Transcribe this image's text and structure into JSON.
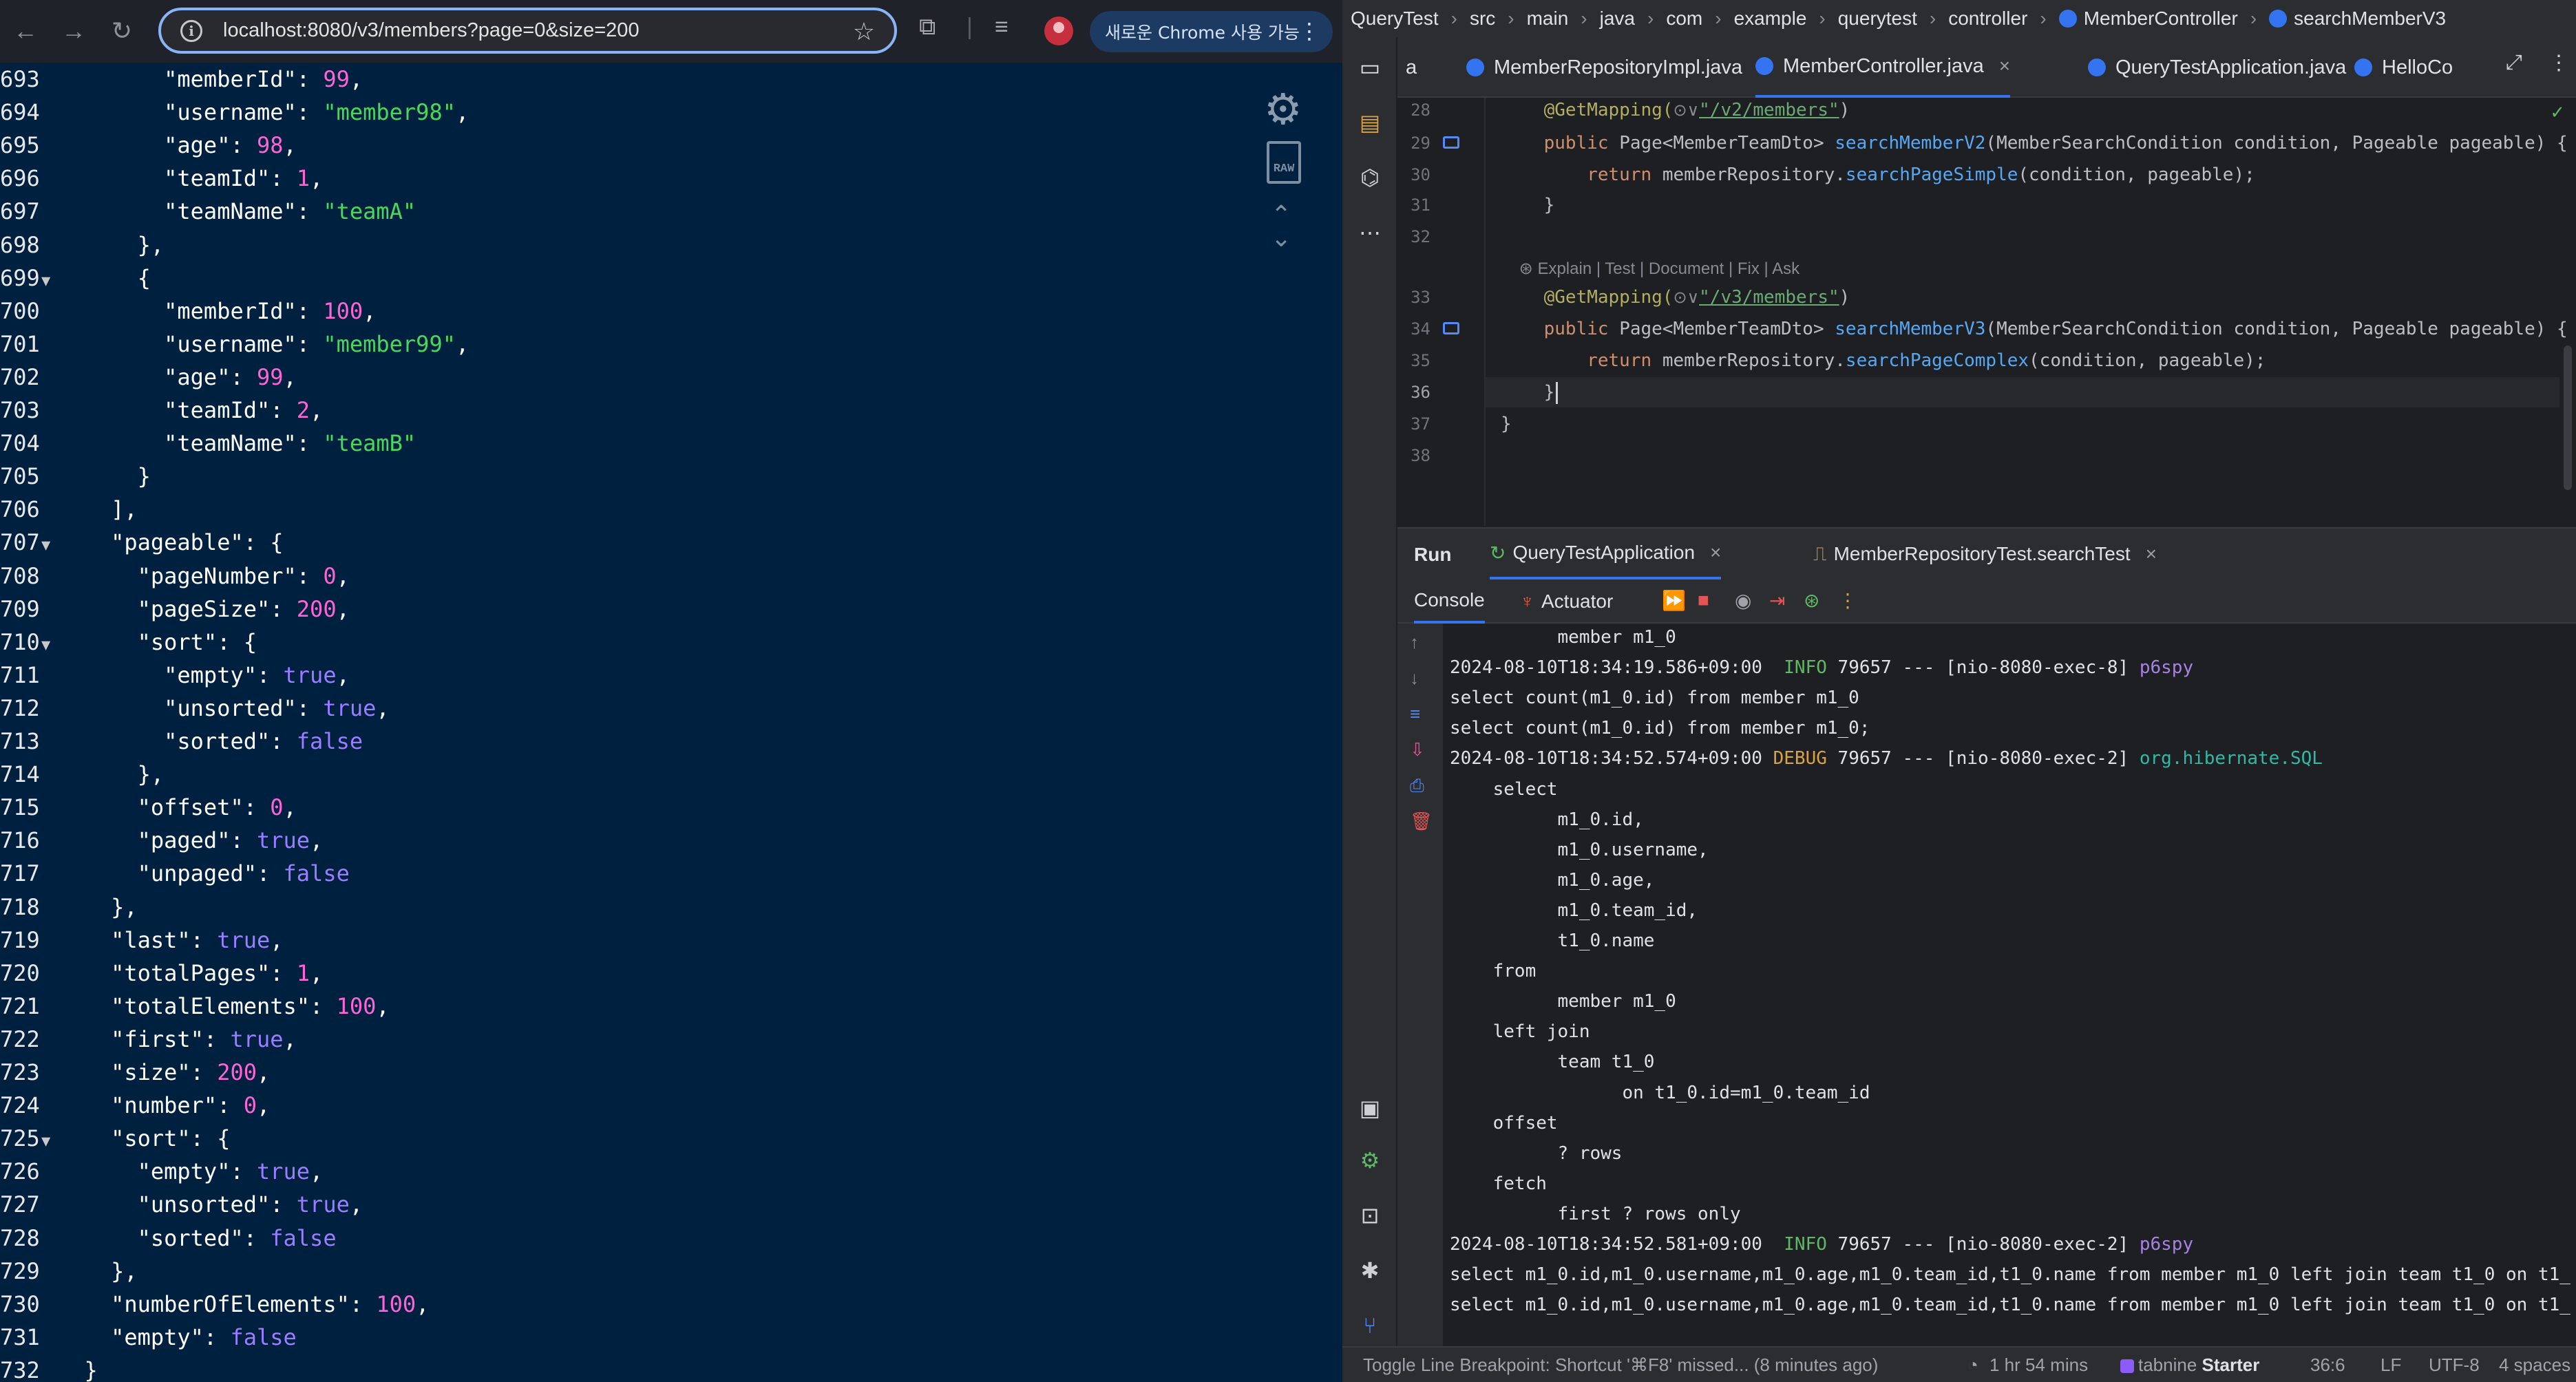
{
  "browser": {
    "url": "localhost:8080/v3/members?page=0&size=200",
    "promo_label": "새로운 Chrome 사용 가능"
  },
  "json_lines": [
    {
      "ln": "693",
      "fold": "",
      "parts": [
        [
          "p",
          "        "
        ],
        [
          "k",
          "\"memberId\""
        ],
        [
          "p",
          ": "
        ],
        [
          "n",
          "99"
        ],
        [
          "p",
          ","
        ]
      ]
    },
    {
      "ln": "694",
      "fold": "",
      "parts": [
        [
          "p",
          "        "
        ],
        [
          "k",
          "\"username\""
        ],
        [
          "p",
          ": "
        ],
        [
          "s",
          "\"member98\""
        ],
        [
          "p",
          ","
        ]
      ]
    },
    {
      "ln": "695",
      "fold": "",
      "parts": [
        [
          "p",
          "        "
        ],
        [
          "k",
          "\"age\""
        ],
        [
          "p",
          ": "
        ],
        [
          "n",
          "98"
        ],
        [
          "p",
          ","
        ]
      ]
    },
    {
      "ln": "696",
      "fold": "",
      "parts": [
        [
          "p",
          "        "
        ],
        [
          "k",
          "\"teamId\""
        ],
        [
          "p",
          ": "
        ],
        [
          "n",
          "1"
        ],
        [
          "p",
          ","
        ]
      ]
    },
    {
      "ln": "697",
      "fold": "",
      "parts": [
        [
          "p",
          "        "
        ],
        [
          "k",
          "\"teamName\""
        ],
        [
          "p",
          ": "
        ],
        [
          "s",
          "\"teamA\""
        ]
      ]
    },
    {
      "ln": "698",
      "fold": "",
      "parts": [
        [
          "p",
          "      },"
        ]
      ]
    },
    {
      "ln": "699",
      "fold": "▼",
      "parts": [
        [
          "p",
          "      {"
        ]
      ]
    },
    {
      "ln": "700",
      "fold": "",
      "parts": [
        [
          "p",
          "        "
        ],
        [
          "k",
          "\"memberId\""
        ],
        [
          "p",
          ": "
        ],
        [
          "n",
          "100"
        ],
        [
          "p",
          ","
        ]
      ]
    },
    {
      "ln": "701",
      "fold": "",
      "parts": [
        [
          "p",
          "        "
        ],
        [
          "k",
          "\"username\""
        ],
        [
          "p",
          ": "
        ],
        [
          "s",
          "\"member99\""
        ],
        [
          "p",
          ","
        ]
      ]
    },
    {
      "ln": "702",
      "fold": "",
      "parts": [
        [
          "p",
          "        "
        ],
        [
          "k",
          "\"age\""
        ],
        [
          "p",
          ": "
        ],
        [
          "n",
          "99"
        ],
        [
          "p",
          ","
        ]
      ]
    },
    {
      "ln": "703",
      "fold": "",
      "parts": [
        [
          "p",
          "        "
        ],
        [
          "k",
          "\"teamId\""
        ],
        [
          "p",
          ": "
        ],
        [
          "n",
          "2"
        ],
        [
          "p",
          ","
        ]
      ]
    },
    {
      "ln": "704",
      "fold": "",
      "parts": [
        [
          "p",
          "        "
        ],
        [
          "k",
          "\"teamName\""
        ],
        [
          "p",
          ": "
        ],
        [
          "s",
          "\"teamB\""
        ]
      ]
    },
    {
      "ln": "705",
      "fold": "",
      "parts": [
        [
          "p",
          "      }"
        ]
      ]
    },
    {
      "ln": "706",
      "fold": "",
      "parts": [
        [
          "p",
          "    ],"
        ]
      ]
    },
    {
      "ln": "707",
      "fold": "▼",
      "parts": [
        [
          "p",
          "    "
        ],
        [
          "k",
          "\"pageable\""
        ],
        [
          "p",
          ": {"
        ]
      ]
    },
    {
      "ln": "708",
      "fold": "",
      "parts": [
        [
          "p",
          "      "
        ],
        [
          "k",
          "\"pageNumber\""
        ],
        [
          "p",
          ": "
        ],
        [
          "n",
          "0"
        ],
        [
          "p",
          ","
        ]
      ]
    },
    {
      "ln": "709",
      "fold": "",
      "parts": [
        [
          "p",
          "      "
        ],
        [
          "k",
          "\"pageSize\""
        ],
        [
          "p",
          ": "
        ],
        [
          "n",
          "200"
        ],
        [
          "p",
          ","
        ]
      ]
    },
    {
      "ln": "710",
      "fold": "▼",
      "parts": [
        [
          "p",
          "      "
        ],
        [
          "k",
          "\"sort\""
        ],
        [
          "p",
          ": {"
        ]
      ]
    },
    {
      "ln": "711",
      "fold": "",
      "parts": [
        [
          "p",
          "        "
        ],
        [
          "k",
          "\"empty\""
        ],
        [
          "p",
          ": "
        ],
        [
          "b",
          "true"
        ],
        [
          "p",
          ","
        ]
      ]
    },
    {
      "ln": "712",
      "fold": "",
      "parts": [
        [
          "p",
          "        "
        ],
        [
          "k",
          "\"unsorted\""
        ],
        [
          "p",
          ": "
        ],
        [
          "b",
          "true"
        ],
        [
          "p",
          ","
        ]
      ]
    },
    {
      "ln": "713",
      "fold": "",
      "parts": [
        [
          "p",
          "        "
        ],
        [
          "k",
          "\"sorted\""
        ],
        [
          "p",
          ": "
        ],
        [
          "b",
          "false"
        ]
      ]
    },
    {
      "ln": "714",
      "fold": "",
      "parts": [
        [
          "p",
          "      },"
        ]
      ]
    },
    {
      "ln": "715",
      "fold": "",
      "parts": [
        [
          "p",
          "      "
        ],
        [
          "k",
          "\"offset\""
        ],
        [
          "p",
          ": "
        ],
        [
          "n",
          "0"
        ],
        [
          "p",
          ","
        ]
      ]
    },
    {
      "ln": "716",
      "fold": "",
      "parts": [
        [
          "p",
          "      "
        ],
        [
          "k",
          "\"paged\""
        ],
        [
          "p",
          ": "
        ],
        [
          "b",
          "true"
        ],
        [
          "p",
          ","
        ]
      ]
    },
    {
      "ln": "717",
      "fold": "",
      "parts": [
        [
          "p",
          "      "
        ],
        [
          "k",
          "\"unpaged\""
        ],
        [
          "p",
          ": "
        ],
        [
          "b",
          "false"
        ]
      ]
    },
    {
      "ln": "718",
      "fold": "",
      "parts": [
        [
          "p",
          "    },"
        ]
      ]
    },
    {
      "ln": "719",
      "fold": "",
      "parts": [
        [
          "p",
          "    "
        ],
        [
          "k",
          "\"last\""
        ],
        [
          "p",
          ": "
        ],
        [
          "b",
          "true"
        ],
        [
          "p",
          ","
        ]
      ]
    },
    {
      "ln": "720",
      "fold": "",
      "parts": [
        [
          "p",
          "    "
        ],
        [
          "k",
          "\"totalPages\""
        ],
        [
          "p",
          ": "
        ],
        [
          "n",
          "1"
        ],
        [
          "p",
          ","
        ]
      ]
    },
    {
      "ln": "721",
      "fold": "",
      "parts": [
        [
          "p",
          "    "
        ],
        [
          "k",
          "\"totalElements\""
        ],
        [
          "p",
          ": "
        ],
        [
          "n",
          "100"
        ],
        [
          "p",
          ","
        ]
      ]
    },
    {
      "ln": "722",
      "fold": "",
      "parts": [
        [
          "p",
          "    "
        ],
        [
          "k",
          "\"first\""
        ],
        [
          "p",
          ": "
        ],
        [
          "b",
          "true"
        ],
        [
          "p",
          ","
        ]
      ]
    },
    {
      "ln": "723",
      "fold": "",
      "parts": [
        [
          "p",
          "    "
        ],
        [
          "k",
          "\"size\""
        ],
        [
          "p",
          ": "
        ],
        [
          "n",
          "200"
        ],
        [
          "p",
          ","
        ]
      ]
    },
    {
      "ln": "724",
      "fold": "",
      "parts": [
        [
          "p",
          "    "
        ],
        [
          "k",
          "\"number\""
        ],
        [
          "p",
          ": "
        ],
        [
          "n",
          "0"
        ],
        [
          "p",
          ","
        ]
      ]
    },
    {
      "ln": "725",
      "fold": "▼",
      "parts": [
        [
          "p",
          "    "
        ],
        [
          "k",
          "\"sort\""
        ],
        [
          "p",
          ": {"
        ]
      ]
    },
    {
      "ln": "726",
      "fold": "",
      "parts": [
        [
          "p",
          "      "
        ],
        [
          "k",
          "\"empty\""
        ],
        [
          "p",
          ": "
        ],
        [
          "b",
          "true"
        ],
        [
          "p",
          ","
        ]
      ]
    },
    {
      "ln": "727",
      "fold": "",
      "parts": [
        [
          "p",
          "      "
        ],
        [
          "k",
          "\"unsorted\""
        ],
        [
          "p",
          ": "
        ],
        [
          "b",
          "true"
        ],
        [
          "p",
          ","
        ]
      ]
    },
    {
      "ln": "728",
      "fold": "",
      "parts": [
        [
          "p",
          "      "
        ],
        [
          "k",
          "\"sorted\""
        ],
        [
          "p",
          ": "
        ],
        [
          "b",
          "false"
        ]
      ]
    },
    {
      "ln": "729",
      "fold": "",
      "parts": [
        [
          "p",
          "    },"
        ]
      ]
    },
    {
      "ln": "730",
      "fold": "",
      "parts": [
        [
          "p",
          "    "
        ],
        [
          "k",
          "\"numberOfElements\""
        ],
        [
          "p",
          ": "
        ],
        [
          "n",
          "100"
        ],
        [
          "p",
          ","
        ]
      ]
    },
    {
      "ln": "731",
      "fold": "",
      "parts": [
        [
          "p",
          "    "
        ],
        [
          "k",
          "\"empty\""
        ],
        [
          "p",
          ": "
        ],
        [
          "b",
          "false"
        ]
      ]
    },
    {
      "ln": "732",
      "fold": "",
      "parts": [
        [
          "p",
          "  }"
        ]
      ]
    }
  ],
  "json_view": {
    "raw_label": "RAW"
  },
  "ide": {
    "breadcrumb": [
      "QueryTest",
      "src",
      "main",
      "java",
      "com",
      "example",
      "querytest",
      "controller",
      "MemberController",
      "searchMemberV3"
    ],
    "editor_tabs": [
      {
        "label": "a",
        "active": false,
        "closable": false
      },
      {
        "label": "MemberRepositoryImpl.java",
        "active": false,
        "closable": false
      },
      {
        "label": "MemberController.java",
        "active": true,
        "closable": true
      },
      {
        "label": "QueryTestApplication.java",
        "active": false,
        "closable": false
      },
      {
        "label": "HelloCo",
        "active": false,
        "closable": false
      }
    ],
    "code_lines": [
      {
        "ln": "28",
        "mark": false,
        "parts": [
          [
            "a",
            "    @GetMapping("
          ],
          [
            "h",
            "⊙∨"
          ],
          [
            "str",
            "\"/v2/members\""
          ],
          [
            "t",
            ")"
          ]
        ]
      },
      {
        "ln": "29",
        "mark": true,
        "parts": [
          [
            "kw",
            "    public "
          ],
          [
            "t",
            "Page<MemberTeamDto> "
          ],
          [
            "fn",
            "searchMemberV2"
          ],
          [
            "t",
            "(MemberSearchCondition condition, Pageable pageable) {"
          ]
        ]
      },
      {
        "ln": "30",
        "mark": false,
        "parts": [
          [
            "kw",
            "        return "
          ],
          [
            "t",
            "memberRepository."
          ],
          [
            "fn",
            "searchPageSimple"
          ],
          [
            "t",
            "(condition, pageable);"
          ]
        ]
      },
      {
        "ln": "31",
        "mark": false,
        "parts": [
          [
            "t",
            "    }"
          ]
        ]
      },
      {
        "ln": "32",
        "mark": false,
        "parts": [
          [
            "t",
            ""
          ]
        ]
      },
      {
        "ln": "",
        "mark": false,
        "parts": [
          [
            "h",
            "    ⊛ Explain | Test | Document | Fix | Ask"
          ]
        ]
      },
      {
        "ln": "33",
        "mark": false,
        "parts": [
          [
            "a",
            "    @GetMapping("
          ],
          [
            "h",
            "⊙∨"
          ],
          [
            "str",
            "\"/v3/members\""
          ],
          [
            "t",
            ")"
          ]
        ]
      },
      {
        "ln": "34",
        "mark": true,
        "parts": [
          [
            "kw",
            "    public "
          ],
          [
            "t",
            "Page<MemberTeamDto> "
          ],
          [
            "fn",
            "searchMemberV3"
          ],
          [
            "t",
            "(MemberSearchCondition condition, Pageable pageable) {"
          ]
        ]
      },
      {
        "ln": "35",
        "mark": false,
        "parts": [
          [
            "kw",
            "        return "
          ],
          [
            "t",
            "memberRepository."
          ],
          [
            "fn",
            "searchPageComplex"
          ],
          [
            "t",
            "(condition, pageable);"
          ]
        ]
      },
      {
        "ln": "36",
        "mark": false,
        "cur": true,
        "parts": [
          [
            "t",
            "    }"
          ]
        ]
      },
      {
        "ln": "37",
        "mark": false,
        "parts": [
          [
            "t",
            "}"
          ]
        ]
      },
      {
        "ln": "38",
        "mark": false,
        "parts": [
          [
            "t",
            ""
          ]
        ]
      }
    ],
    "run": {
      "title": "Run",
      "tabs": [
        {
          "label": "QueryTestApplication",
          "active": true
        },
        {
          "label": "MemberRepositoryTest.searchTest",
          "active": false
        }
      ],
      "toolbar_console": "Console",
      "toolbar_actuator": "Actuator"
    },
    "console_lines": [
      {
        "parts": [
          [
            "t",
            "          member m1_0"
          ]
        ]
      },
      {
        "parts": [
          [
            "t",
            "2024-08-10T18:34:19.586+09:00  "
          ],
          [
            "info",
            "INFO"
          ],
          [
            "t",
            " 79657 --- [nio-8080-exec-8] "
          ],
          [
            "p6",
            "p6spy"
          ]
        ]
      },
      {
        "parts": [
          [
            "t",
            "select count(m1_0.id) from member m1_0"
          ]
        ]
      },
      {
        "parts": [
          [
            "t",
            "select count(m1_0.id) from member m1_0;"
          ]
        ]
      },
      {
        "parts": [
          [
            "t",
            "2024-08-10T18:34:52.574+09:00 "
          ],
          [
            "debug",
            "DEBUG"
          ],
          [
            "t",
            " 79657 --- [nio-8080-exec-2] "
          ],
          [
            "sql",
            "org.hibernate.SQL"
          ]
        ]
      },
      {
        "parts": [
          [
            "t",
            "    select"
          ]
        ]
      },
      {
        "parts": [
          [
            "t",
            "          m1_0.id,"
          ]
        ]
      },
      {
        "parts": [
          [
            "t",
            "          m1_0.username,"
          ]
        ]
      },
      {
        "parts": [
          [
            "t",
            "          m1_0.age,"
          ]
        ]
      },
      {
        "parts": [
          [
            "t",
            "          m1_0.team_id,"
          ]
        ]
      },
      {
        "parts": [
          [
            "t",
            "          t1_0.name"
          ]
        ]
      },
      {
        "parts": [
          [
            "t",
            "    from"
          ]
        ]
      },
      {
        "parts": [
          [
            "t",
            "          member m1_0"
          ]
        ]
      },
      {
        "parts": [
          [
            "t",
            "    left join"
          ]
        ]
      },
      {
        "parts": [
          [
            "t",
            "          team t1_0"
          ]
        ]
      },
      {
        "parts": [
          [
            "t",
            "                on t1_0.id=m1_0.team_id"
          ]
        ]
      },
      {
        "parts": [
          [
            "t",
            "    offset"
          ]
        ]
      },
      {
        "parts": [
          [
            "t",
            "          ? rows"
          ]
        ]
      },
      {
        "parts": [
          [
            "t",
            "    fetch"
          ]
        ]
      },
      {
        "parts": [
          [
            "t",
            "          first ? rows only"
          ]
        ]
      },
      {
        "parts": [
          [
            "t",
            "2024-08-10T18:34:52.581+09:00  "
          ],
          [
            "info",
            "INFO"
          ],
          [
            "t",
            " 79657 --- [nio-8080-exec-2] "
          ],
          [
            "p6",
            "p6spy"
          ]
        ]
      },
      {
        "parts": [
          [
            "t",
            "select m1_0.id,m1_0.username,m1_0.age,m1_0.team_id,t1_0.name from member m1_0 left join team t1_0 on t1_"
          ]
        ]
      },
      {
        "parts": [
          [
            "t",
            "select m1_0.id,m1_0.username,m1_0.age,m1_0.team_id,t1_0.name from member m1_0 left join team t1_0 on t1_"
          ]
        ]
      }
    ],
    "status": {
      "message": "Toggle Line Breakpoint: Shortcut '⌘F8' missed... (8 minutes ago)",
      "time": "1 hr 54 mins",
      "tabnine": "tabnine",
      "tabnine_plan": "Starter",
      "position": "36:6",
      "line_sep": "LF",
      "encoding": "UTF-8",
      "indent": "4 spaces"
    }
  }
}
